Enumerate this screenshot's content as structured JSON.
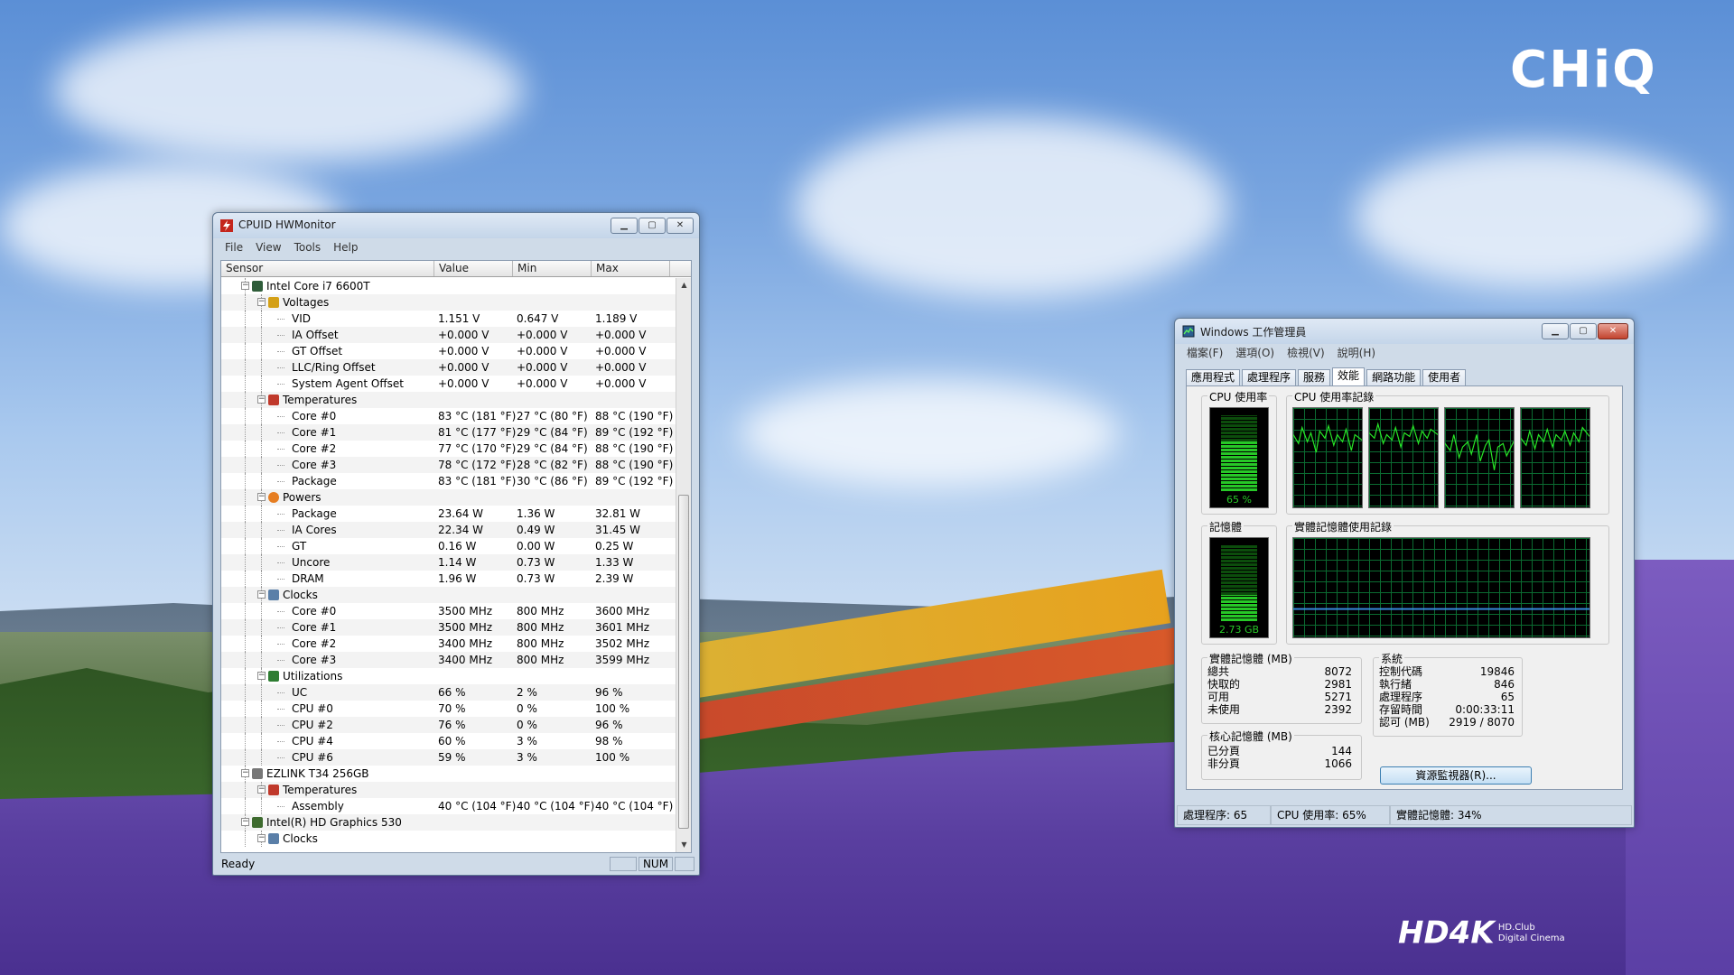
{
  "desktop": {
    "brand_logo": "CHiQ",
    "watermark_big": "HD4K",
    "watermark_line1": "HD.Club",
    "watermark_line2": "Digital Cinema"
  },
  "hwmonitor": {
    "title": "CPUID HWMonitor",
    "menu": [
      "File",
      "View",
      "Tools",
      "Help"
    ],
    "columns": [
      "Sensor",
      "Value",
      "Min",
      "Max"
    ],
    "status": "Ready",
    "num_indicator": "NUM",
    "rows": [
      {
        "level": 1,
        "type": "device",
        "icon": "cpu-icon",
        "label": "Intel Core i7 6600T",
        "value": "",
        "min": "",
        "max": ""
      },
      {
        "level": 2,
        "type": "group",
        "icon": "voltage-icon",
        "label": "Voltages",
        "value": "",
        "min": "",
        "max": ""
      },
      {
        "level": 3,
        "label": "VID",
        "value": "1.151 V",
        "min": "0.647 V",
        "max": "1.189 V"
      },
      {
        "level": 3,
        "label": "IA Offset",
        "value": "+0.000 V",
        "min": "+0.000 V",
        "max": "+0.000 V"
      },
      {
        "level": 3,
        "label": "GT Offset",
        "value": "+0.000 V",
        "min": "+0.000 V",
        "max": "+0.000 V"
      },
      {
        "level": 3,
        "label": "LLC/Ring Offset",
        "value": "+0.000 V",
        "min": "+0.000 V",
        "max": "+0.000 V"
      },
      {
        "level": 3,
        "label": "System Agent Offset",
        "value": "+0.000 V",
        "min": "+0.000 V",
        "max": "+0.000 V"
      },
      {
        "level": 2,
        "type": "group",
        "icon": "thermometer-icon",
        "label": "Temperatures",
        "value": "",
        "min": "",
        "max": ""
      },
      {
        "level": 3,
        "label": "Core #0",
        "value": "83 °C  (181 °F)",
        "min": "27 °C  (80 °F)",
        "max": "88 °C  (190 °F)"
      },
      {
        "level": 3,
        "label": "Core #1",
        "value": "81 °C  (177 °F)",
        "min": "29 °C  (84 °F)",
        "max": "89 °C  (192 °F)"
      },
      {
        "level": 3,
        "label": "Core #2",
        "value": "77 °C  (170 °F)",
        "min": "29 °C  (84 °F)",
        "max": "88 °C  (190 °F)"
      },
      {
        "level": 3,
        "label": "Core #3",
        "value": "78 °C  (172 °F)",
        "min": "28 °C  (82 °F)",
        "max": "88 °C  (190 °F)"
      },
      {
        "level": 3,
        "label": "Package",
        "value": "83 °C  (181 °F)",
        "min": "30 °C  (86 °F)",
        "max": "89 °C  (192 °F)"
      },
      {
        "level": 2,
        "type": "group",
        "icon": "power-icon",
        "label": "Powers",
        "value": "",
        "min": "",
        "max": ""
      },
      {
        "level": 3,
        "label": "Package",
        "value": "23.64 W",
        "min": "1.36 W",
        "max": "32.81 W"
      },
      {
        "level": 3,
        "label": "IA Cores",
        "value": "22.34 W",
        "min": "0.49 W",
        "max": "31.45 W"
      },
      {
        "level": 3,
        "label": "GT",
        "value": "0.16 W",
        "min": "0.00 W",
        "max": "0.25 W"
      },
      {
        "level": 3,
        "label": "Uncore",
        "value": "1.14 W",
        "min": "0.73 W",
        "max": "1.33 W"
      },
      {
        "level": 3,
        "label": "DRAM",
        "value": "1.96 W",
        "min": "0.73 W",
        "max": "2.39 W"
      },
      {
        "level": 2,
        "type": "group",
        "icon": "clock-icon",
        "label": "Clocks",
        "value": "",
        "min": "",
        "max": ""
      },
      {
        "level": 3,
        "label": "Core #0",
        "value": "3500 MHz",
        "min": "800 MHz",
        "max": "3600 MHz"
      },
      {
        "level": 3,
        "label": "Core #1",
        "value": "3500 MHz",
        "min": "800 MHz",
        "max": "3601 MHz"
      },
      {
        "level": 3,
        "label": "Core #2",
        "value": "3400 MHz",
        "min": "800 MHz",
        "max": "3502 MHz"
      },
      {
        "level": 3,
        "label": "Core #3",
        "value": "3400 MHz",
        "min": "800 MHz",
        "max": "3599 MHz"
      },
      {
        "level": 2,
        "type": "group",
        "icon": "utilization-icon",
        "label": "Utilizations",
        "value": "",
        "min": "",
        "max": ""
      },
      {
        "level": 3,
        "label": "UC",
        "value": "66 %",
        "min": "2 %",
        "max": "96 %"
      },
      {
        "level": 3,
        "label": "CPU #0",
        "value": "70 %",
        "min": "0 %",
        "max": "100 %"
      },
      {
        "level": 3,
        "label": "CPU #2",
        "value": "76 %",
        "min": "0 %",
        "max": "96 %"
      },
      {
        "level": 3,
        "label": "CPU #4",
        "value": "60 %",
        "min": "3 %",
        "max": "98 %"
      },
      {
        "level": 3,
        "label": "CPU #6",
        "value": "59 %",
        "min": "3 %",
        "max": "100 %"
      },
      {
        "level": 1,
        "type": "device",
        "icon": "ssd-icon",
        "label": "EZLINK T34 256GB",
        "value": "",
        "min": "",
        "max": ""
      },
      {
        "level": 2,
        "type": "group",
        "icon": "thermometer-icon",
        "label": "Temperatures",
        "value": "",
        "min": "",
        "max": ""
      },
      {
        "level": 3,
        "label": "Assembly",
        "value": "40 °C  (104 °F)",
        "min": "40 °C  (104 °F)",
        "max": "40 °C  (104 °F)"
      },
      {
        "level": 1,
        "type": "device",
        "icon": "gpu-icon",
        "label": "Intel(R) HD Graphics 530",
        "value": "",
        "min": "",
        "max": ""
      },
      {
        "level": 2,
        "type": "group",
        "icon": "clock-icon",
        "label": "Clocks",
        "value": "",
        "min": "",
        "max": ""
      }
    ]
  },
  "taskmgr": {
    "title": "Windows 工作管理員",
    "menu": [
      "檔案(F)",
      "選項(O)",
      "檢視(V)",
      "說明(H)"
    ],
    "tabs": [
      "應用程式",
      "處理程序",
      "服務",
      "效能",
      "網路功能",
      "使用者"
    ],
    "active_tab": 3,
    "cpu_usage_title": "CPU 使用率",
    "cpu_history_title": "CPU 使用率記錄",
    "memory_title": "記憶體",
    "memory_history_title": "實體記憶體使用記錄",
    "cpu_percent_label": "65 %",
    "cpu_fraction": 0.65,
    "memory_label": "2.73 GB",
    "memory_fraction": 0.34,
    "physical_memory": {
      "title": "實體記憶體 (MB)",
      "rows": [
        {
          "label": "總共",
          "value": "8072"
        },
        {
          "label": "快取的",
          "value": "2981"
        },
        {
          "label": "可用",
          "value": "5271"
        },
        {
          "label": "未使用",
          "value": "2392"
        }
      ]
    },
    "kernel_memory": {
      "title": "核心記憶體 (MB)",
      "rows": [
        {
          "label": "已分頁",
          "value": "144"
        },
        {
          "label": "非分頁",
          "value": "1066"
        }
      ]
    },
    "system": {
      "title": "系統",
      "rows": [
        {
          "label": "控制代碼",
          "value": "19846"
        },
        {
          "label": "執行緒",
          "value": "846"
        },
        {
          "label": "處理程序",
          "value": "65"
        },
        {
          "label": "存留時間",
          "value": "0:00:33:11"
        },
        {
          "label": "認可 (MB)",
          "value": "2919 / 8070"
        }
      ]
    },
    "resource_monitor_button": "資源監視器(R)...",
    "status": {
      "processes": "處理程序: 65",
      "cpu": "CPU 使用率: 65%",
      "memory": "實體記憶體: 34%"
    }
  }
}
